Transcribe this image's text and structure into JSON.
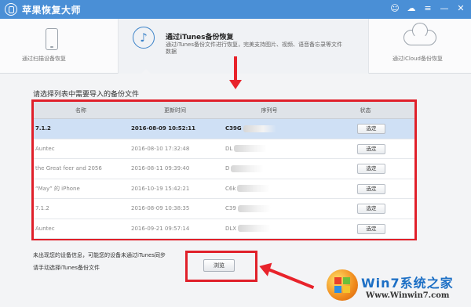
{
  "app": {
    "title": "苹果恢复大师",
    "controls": [
      "weibo-icon",
      "chat-icon",
      "menu-icon",
      "minimize-icon",
      "close-icon"
    ]
  },
  "modes": {
    "device": {
      "label": "通过扫描设备恢复"
    },
    "itunes": {
      "title": "通过iTunes备份恢复",
      "desc": "通过iTunes备份文件进行恢复，完美支持图片、视频、语音备忘录等文件数据"
    },
    "icloud": {
      "label": "通过iCloud备份恢复"
    }
  },
  "list": {
    "heading": "请选择列表中需要导入的备份文件",
    "columns": [
      "名称",
      "更新时间",
      "序列号",
      "状态"
    ],
    "select_label": "选定",
    "rows": [
      {
        "name": "7.1.2",
        "time": "2016-08-09 10:52:11",
        "serial": "C39G",
        "selected": true
      },
      {
        "name": "Auntec",
        "time": "2016-08-10 17:32:48",
        "serial": "DL",
        "selected": false
      },
      {
        "name": "the Great feer and 2056",
        "time": "2016-08-11 09:39:40",
        "serial": "D",
        "selected": false
      },
      {
        "name": "“May” 的 iPhone",
        "time": "2016-10-19 15:42:21",
        "serial": "C6k",
        "selected": false
      },
      {
        "name": "7.1.2",
        "time": "2016-08-09 10:38:35",
        "serial": "C39",
        "selected": false
      },
      {
        "name": "Auntec",
        "time": "2016-09-21 09:57:14",
        "serial": "DLX",
        "selected": false
      }
    ]
  },
  "hint": {
    "line1": "未出现您的设备信息，可能您的设备未通过iTunes同步",
    "line2": "请手动选择iTunes备份文件"
  },
  "browse_label": "浏览",
  "watermark": {
    "title": "Win7系统之家",
    "url": "Www.Winwin7.com"
  },
  "colors": {
    "titlebar": "#4a8fd6",
    "accent": "#3c83c9",
    "annotation_red": "#e0202a",
    "selected_row": "#cfe0f5"
  }
}
